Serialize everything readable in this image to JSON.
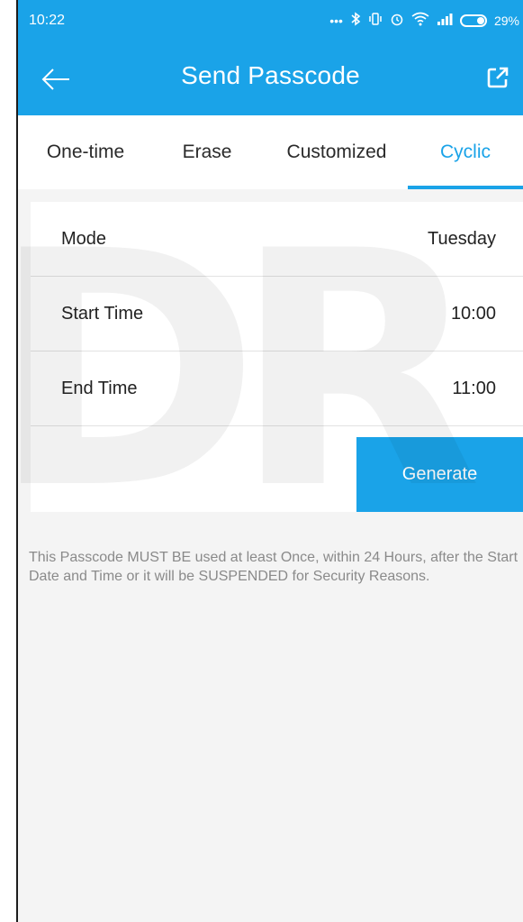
{
  "status_bar": {
    "time": "10:22",
    "icons": [
      "more-dots-icon",
      "bluetooth-icon",
      "vibrate-icon",
      "alarm-icon",
      "wifi-icon",
      "signal-icon",
      "battery-icon"
    ],
    "battery": "29%"
  },
  "app_bar": {
    "title": "Send Passcode",
    "background_color": "#1aa3e8"
  },
  "tabs": [
    {
      "label": "One-time",
      "active": false
    },
    {
      "label": "Erase",
      "active": false
    },
    {
      "label": "Customized",
      "active": false
    },
    {
      "label": "Cyclic",
      "active": true
    }
  ],
  "form": {
    "rows": [
      {
        "label": "Mode",
        "value": "Tuesday"
      },
      {
        "label": "Start Time",
        "value": "10:00"
      },
      {
        "label": "End Time",
        "value": "11:00"
      }
    ],
    "generate_label": "Generate"
  },
  "note": "This Passcode MUST BE used at least Once, within 24 Hours, after the Start Date and Time or it will be SUSPENDED for Security Reasons.",
  "watermark": "DR"
}
